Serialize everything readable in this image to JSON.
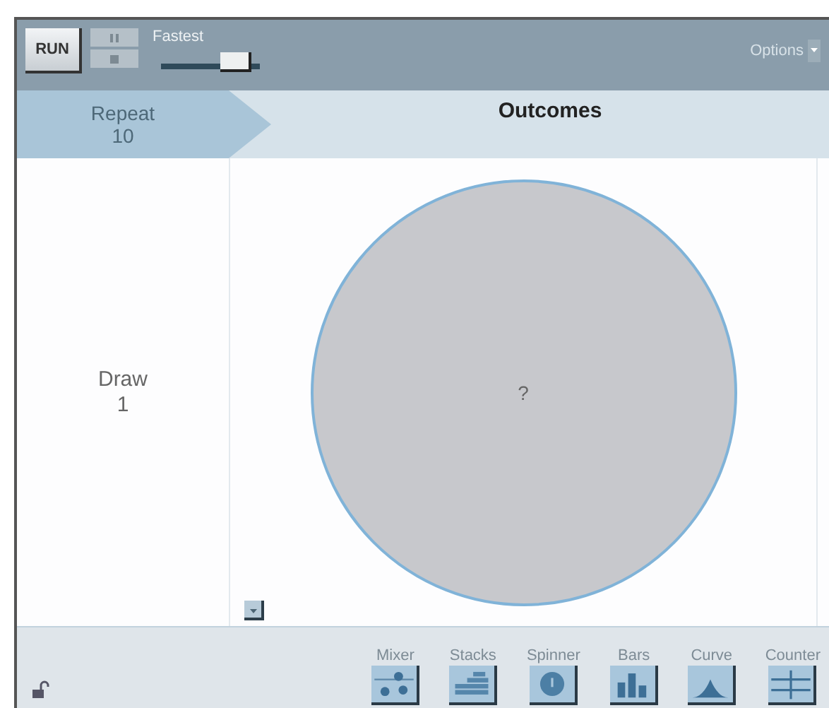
{
  "toolbar": {
    "run_label": "RUN",
    "speed": {
      "label": "Fastest",
      "level": 0.8
    },
    "options_label": "Options"
  },
  "header": {
    "repeat": {
      "label": "Repeat",
      "value": "10"
    },
    "outcomes": {
      "label": "Outcomes"
    }
  },
  "draw": {
    "label": "Draw",
    "value": "1"
  },
  "device": {
    "kind": "spinner",
    "center_label": "?"
  },
  "locked": false,
  "devices": [
    {
      "label": "Mixer",
      "kind": "mixer"
    },
    {
      "label": "Stacks",
      "kind": "stacks"
    },
    {
      "label": "Spinner",
      "kind": "spinner"
    },
    {
      "label": "Bars",
      "kind": "bars"
    },
    {
      "label": "Curve",
      "kind": "curve"
    },
    {
      "label": "Counter",
      "kind": "counter"
    }
  ]
}
